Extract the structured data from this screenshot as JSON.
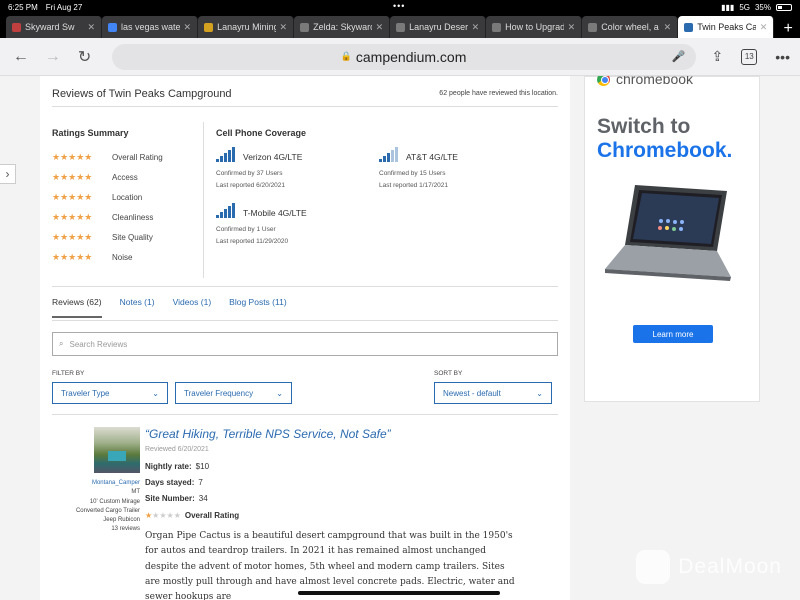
{
  "status": {
    "time": "6:25 PM",
    "date": "Fri Aug 27",
    "network": "5G",
    "battery": "35%"
  },
  "tabs": [
    {
      "title": "Skyward Sw",
      "color": "#c04040"
    },
    {
      "title": "las vegas water",
      "color": "#4285f4"
    },
    {
      "title": "Lanayru Mining",
      "color": "#d4a020"
    },
    {
      "title": "Zelda: Skyward",
      "color": "#7a7a7a"
    },
    {
      "title": "Lanayru Desert",
      "color": "#7a7a7a"
    },
    {
      "title": "How to Upgrade",
      "color": "#7a7a7a"
    },
    {
      "title": "Color wheel, a",
      "color": "#7a7a7a"
    },
    {
      "title": "Twin Peaks Ca",
      "color": "#2a6bb0"
    }
  ],
  "browser": {
    "url": "campendium.com",
    "tab_count": "13"
  },
  "page": {
    "title": "Reviews of Twin Peaks Campground",
    "review_count": "62 people have reviewed this location.",
    "ratings_title": "Ratings Summary",
    "ratings": [
      {
        "label": "Overall Rating",
        "stars": "★★★★★"
      },
      {
        "label": "Access",
        "stars": "★★★★★"
      },
      {
        "label": "Location",
        "stars": "★★★★★"
      },
      {
        "label": "Cleanliness",
        "stars": "★★★★★"
      },
      {
        "label": "Site Quality",
        "stars": "★★★★★"
      },
      {
        "label": "Noise",
        "stars": "★★★★★"
      }
    ],
    "cell_title": "Cell Phone Coverage",
    "carriers": [
      {
        "name": "Verizon 4G/LTE",
        "confirmed": "Confirmed by 37 Users",
        "reported": "Last reported 6/20/2021"
      },
      {
        "name": "AT&T 4G/LTE",
        "confirmed": "Confirmed by 15 Users",
        "reported": "Last reported 1/17/2021"
      },
      {
        "name": "T-Mobile 4G/LTE",
        "confirmed": "Confirmed by 1 User",
        "reported": "Last reported 11/29/2020"
      }
    ],
    "review_tabs": [
      "Reviews (62)",
      "Notes (1)",
      "Videos (1)",
      "Blog Posts (11)"
    ],
    "search_placeholder": "Search Reviews",
    "filter_by": "FILTER BY",
    "sort_by": "SORT BY",
    "filter1": "Traveler Type",
    "filter2": "Traveler Frequency",
    "sort": "Newest - default"
  },
  "review": {
    "username": "Montana_Camper",
    "state": "MT",
    "rig": "10' Custom Mirage Converted Cargo Trailer",
    "vehicle": "Jeep Rubicon",
    "reviews": "13 reviews",
    "title": "“Great Hiking, Terrible NPS Service, Not Safe”",
    "date": "Reviewed 6/20/2021",
    "nightly_label": "Nightly rate:",
    "nightly": "$10",
    "days_label": "Days stayed:",
    "days": "7",
    "site_label": "Site Number:",
    "site": "34",
    "overall_stars_on": "★",
    "overall_stars_off": "★★★★",
    "overall_label": "Overall Rating",
    "body": "Organ Pipe Cactus is a beautiful desert campground that was built in the 1950's for autos and teardrop trailers. In 2021 it has remained almost unchanged despite the advent of motor homes, 5th wheel and modern camp trailers. Sites are mostly pull through and have almost level concrete pads. Electric, water and sewer hookups are"
  },
  "ad": {
    "logo": "chromebook",
    "line1": "Switch to",
    "line2": "Chromebook.",
    "button": "Learn more"
  },
  "watermark": "DealMoon"
}
